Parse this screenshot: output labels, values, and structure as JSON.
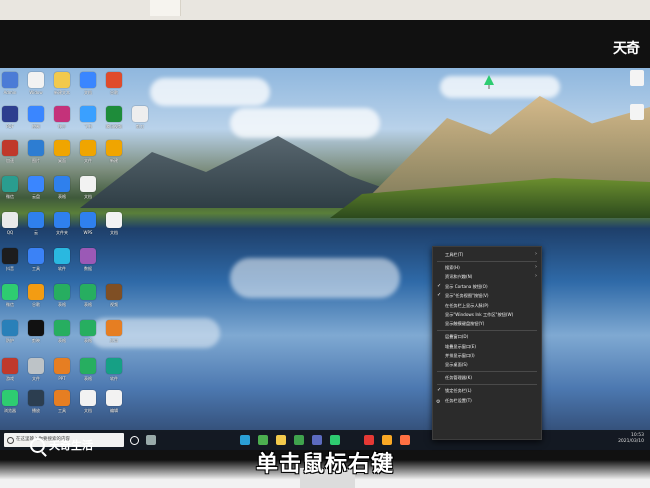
{
  "watermark": {
    "top_right": "天奇",
    "bottom_left": "天奇生活"
  },
  "caption": "单击鼠标右键",
  "desktop": {
    "icons": [
      {
        "label": "Admin",
        "color": "#4b7bd6"
      },
      {
        "label": "Widow",
        "color": "#f2f2f2"
      },
      {
        "label": "新建文本",
        "color": "#f2c94c"
      },
      {
        "label": "文档",
        "color": "#3a86ff"
      },
      {
        "label": "谷歌",
        "color": "#e04b2b"
      },
      {
        "label": "PDF",
        "color": "#2d3e8f"
      },
      {
        "label": "控制",
        "color": "#3a86ff"
      },
      {
        "label": "快手",
        "color": "#c4327a"
      },
      {
        "label": "飞书",
        "color": "#3aa0ff"
      },
      {
        "label": "腾讯视频",
        "color": "#1e8c3a"
      },
      {
        "label": "剪刀",
        "color": "#eeeeee"
      },
      {
        "label": "加速",
        "color": "#c0392b"
      },
      {
        "label": "图片",
        "color": "#2d7dd2"
      },
      {
        "label": "桌面",
        "color": "#f0a500"
      },
      {
        "label": "文件",
        "color": "#f0a500"
      },
      {
        "label": "新建",
        "color": "#f0a500"
      },
      {
        "label": "微信",
        "color": "#2a9d8f"
      },
      {
        "label": "云盘",
        "color": "#3a86ff"
      },
      {
        "label": "表格",
        "color": "#2f80ed"
      },
      {
        "label": "文档",
        "color": "#f2f2f2"
      },
      {
        "label": "QQ",
        "color": "#e9e9e9"
      },
      {
        "label": "云",
        "color": "#2f80ed"
      },
      {
        "label": "文件夹",
        "color": "#2f80ed"
      },
      {
        "label": "WPS",
        "color": "#2f80ed"
      },
      {
        "label": "文档",
        "color": "#f2f2f2"
      },
      {
        "label": "抖音",
        "color": "#1d1d1d"
      },
      {
        "label": "工具",
        "color": "#3b82f6"
      },
      {
        "label": "软件",
        "color": "#2ab8e0"
      },
      {
        "label": "数据",
        "color": "#9b59b6"
      },
      {
        "label": "微信",
        "color": "#2ecc71"
      },
      {
        "label": "谷歌",
        "color": "#f39c12"
      },
      {
        "label": "表格",
        "color": "#27ae60"
      },
      {
        "label": "表格",
        "color": "#27ae60"
      },
      {
        "label": "视频",
        "color": "#7f4f24"
      },
      {
        "label": "防护",
        "color": "#2980b9"
      },
      {
        "label": "剪映",
        "color": "#111111"
      },
      {
        "label": "表格",
        "color": "#27ae60"
      },
      {
        "label": "表格",
        "color": "#27ae60"
      },
      {
        "label": "应用",
        "color": "#e67e22"
      },
      {
        "label": "游戏",
        "color": "#c0392b"
      },
      {
        "label": "文件",
        "color": "#bdc3c7"
      },
      {
        "label": "PPT",
        "color": "#e67e22"
      },
      {
        "label": "表格",
        "color": "#27ae60"
      },
      {
        "label": "软件",
        "color": "#16a085"
      },
      {
        "label": "浏览器",
        "color": "#2ecc71"
      },
      {
        "label": "播放",
        "color": "#2c3e50"
      },
      {
        "label": "工具",
        "color": "#e67e22"
      },
      {
        "label": "文档",
        "color": "#f2f2f2"
      },
      {
        "label": "编辑",
        "color": "#f2f2f2"
      }
    ]
  },
  "taskbar": {
    "search_placeholder": "在这里输入你要搜索的内容",
    "time": "10:53",
    "date": "2021/03/10",
    "apps": [
      {
        "name": "start-icon",
        "color": "#ffffff"
      },
      {
        "name": "task-view-icon",
        "color": "#9aa"
      },
      {
        "name": "edge-icon",
        "color": "#2aa0d8"
      },
      {
        "name": "store-icon",
        "color": "#4caf50"
      },
      {
        "name": "explorer-icon",
        "color": "#f2c94c"
      },
      {
        "name": "chrome-icon",
        "color": "#3fa34d"
      },
      {
        "name": "app-icon",
        "color": "#5c6bc0"
      },
      {
        "name": "wechat-icon",
        "color": "#2ecc71"
      },
      {
        "name": "wps-icon",
        "color": "#e53935"
      },
      {
        "name": "app-icon",
        "color": "#f9a825"
      },
      {
        "name": "app-icon",
        "color": "#ff7043"
      }
    ]
  },
  "context_menu": {
    "items": [
      {
        "label": "工具栏(T)",
        "check": false,
        "arrow": true
      },
      {
        "sep": true
      },
      {
        "label": "搜索(H)",
        "check": false,
        "arrow": true
      },
      {
        "label": "资讯和兴趣(N)",
        "check": false,
        "arrow": true
      },
      {
        "label": "显示 Cortana 按钮(O)",
        "check": true,
        "arrow": false
      },
      {
        "label": "显示\"任务视图\"按钮(V)",
        "check": true,
        "arrow": false
      },
      {
        "label": "在任务栏上显示人脉(P)",
        "check": false,
        "arrow": false
      },
      {
        "label": "显示\"Windows Ink 工作区\"按钮(W)",
        "check": false,
        "arrow": false
      },
      {
        "label": "显示触摸键盘按钮(Y)",
        "check": false,
        "arrow": false
      },
      {
        "sep": true
      },
      {
        "label": "层叠窗口(D)",
        "check": false,
        "arrow": false
      },
      {
        "label": "堆叠显示窗口(E)",
        "check": false,
        "arrow": false
      },
      {
        "label": "并排显示窗口(I)",
        "check": false,
        "arrow": false
      },
      {
        "label": "显示桌面(S)",
        "check": false,
        "arrow": false
      },
      {
        "sep": true
      },
      {
        "label": "任务管理器(K)",
        "check": false,
        "arrow": false
      },
      {
        "sep": true
      },
      {
        "label": "锁定任务栏(L)",
        "check": true,
        "arrow": false
      },
      {
        "label": "任务栏设置(T)",
        "check": false,
        "arrow": false,
        "gear": true
      }
    ]
  }
}
